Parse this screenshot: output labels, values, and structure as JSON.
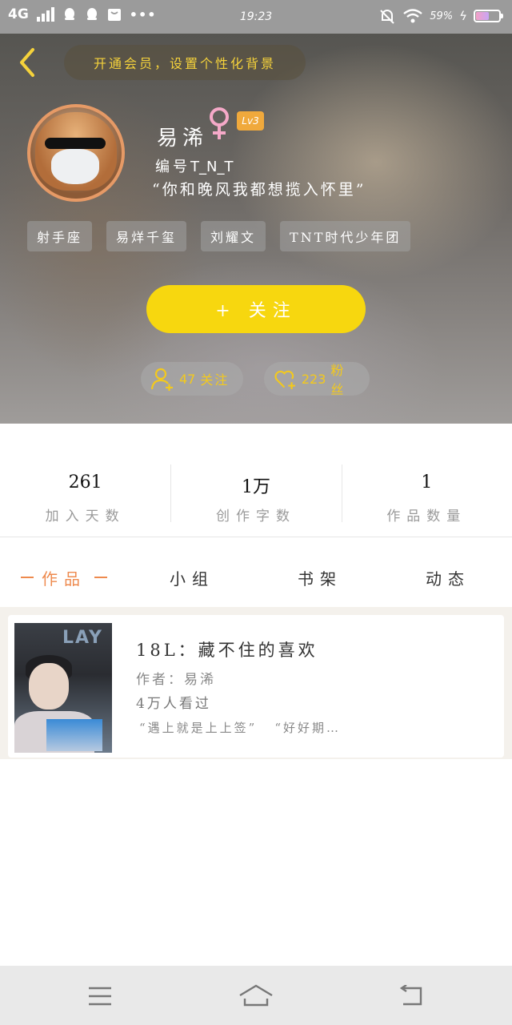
{
  "status_bar": {
    "network": "4G",
    "time": "19:23",
    "battery": "59%",
    "battery_level": 0.59
  },
  "header": {
    "vip_banner": "开通会员，设置个性化背景",
    "user": {
      "name": "易浠",
      "level": "Lv3",
      "id_label": "编号",
      "id_value": "T_N_T",
      "bio": "“你和晚风我都想揽入怀里”"
    },
    "tags": [
      "射手座",
      "易烊千玺",
      "刘耀文",
      "TNT时代少年团"
    ],
    "follow_label": "+ 关注",
    "following": {
      "count": "47",
      "label": "关注"
    },
    "fans": {
      "count": "223",
      "label": "粉丝"
    }
  },
  "stats": [
    {
      "value": "261",
      "label": "加入天数"
    },
    {
      "value": "1万",
      "label": "创作字数"
    },
    {
      "value": "1",
      "label": "作品数量"
    }
  ],
  "tabs": [
    "作品",
    "小组",
    "书架",
    "动态"
  ],
  "active_tab": "作品",
  "works": [
    {
      "title": "18L：藏不住的喜欢",
      "author": "作者：易浠",
      "views": "4万人看过",
      "quotes": [
        "“遇上就是上上签”",
        "“好好期…"
      ]
    }
  ],
  "icons": {
    "back": "chevron-left-icon",
    "gender": "female-icon",
    "following": "person-add-icon",
    "fans": "heart-add-icon",
    "nav": [
      "menu-icon",
      "home-icon",
      "back-arrow-icon"
    ]
  },
  "colors": {
    "accent_yellow": "#f7d70f",
    "active_tab": "#ee8a4e",
    "gender_pink": "#f5a9c8",
    "level_badge": "#f0a93c"
  }
}
